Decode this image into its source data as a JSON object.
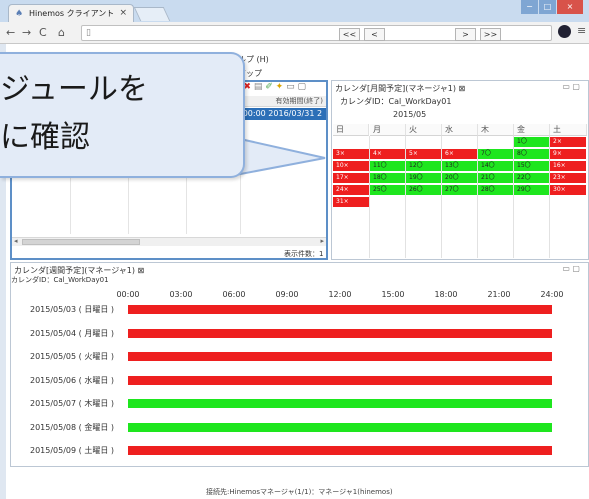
{
  "browser": {
    "tab_title": "Hinemos クライアント",
    "tab_close": "×",
    "address": "",
    "window_controls": [
      "−",
      "□",
      "×"
    ]
  },
  "app": {
    "menu_text": "ルプ (H)",
    "toolbar_text": "アップ",
    "list": {
      "header": "有効期間(終了)",
      "selected_row": ":00:00  2016/03/31 2",
      "count": "表示件数：1",
      "scroll_left": "◂",
      "scroll_right": "▸"
    },
    "monthly": {
      "title": "カレンダ[月間予定](マネージャ1) ⊠",
      "calendar_id": "カレンダID：Cal_WorkDay01",
      "nav": [
        "<<",
        "<",
        ">",
        ">>"
      ],
      "month": "2015/05",
      "weekdays": [
        "日",
        "月",
        "火",
        "水",
        "木",
        "金",
        "土"
      ],
      "weeks": [
        [
          null,
          null,
          null,
          null,
          null,
          {
            "label": "1〇",
            "color": "green"
          },
          {
            "label": "2×",
            "color": "red"
          }
        ],
        [
          {
            "label": "3×",
            "color": "red"
          },
          {
            "label": "4×",
            "color": "red"
          },
          {
            "label": "5×",
            "color": "red"
          },
          {
            "label": "6×",
            "color": "red"
          },
          {
            "label": "7〇",
            "color": "green"
          },
          {
            "label": "8〇",
            "color": "green"
          },
          {
            "label": "9×",
            "color": "red"
          }
        ],
        [
          {
            "label": "10×",
            "color": "red"
          },
          {
            "label": "11〇",
            "color": "green"
          },
          {
            "label": "12〇",
            "color": "green"
          },
          {
            "label": "13〇",
            "color": "green"
          },
          {
            "label": "14〇",
            "color": "green"
          },
          {
            "label": "15〇",
            "color": "green"
          },
          {
            "label": "16×",
            "color": "red"
          }
        ],
        [
          {
            "label": "17×",
            "color": "red"
          },
          {
            "label": "18〇",
            "color": "green"
          },
          {
            "label": "19〇",
            "color": "green"
          },
          {
            "label": "20〇",
            "color": "green"
          },
          {
            "label": "21〇",
            "color": "green"
          },
          {
            "label": "22〇",
            "color": "green"
          },
          {
            "label": "23×",
            "color": "red"
          }
        ],
        [
          {
            "label": "24×",
            "color": "red"
          },
          {
            "label": "25〇",
            "color": "green"
          },
          {
            "label": "26〇",
            "color": "green"
          },
          {
            "label": "27〇",
            "color": "green"
          },
          {
            "label": "28〇",
            "color": "green"
          },
          {
            "label": "29〇",
            "color": "green"
          },
          {
            "label": "30×",
            "color": "red"
          }
        ],
        [
          {
            "label": "31×",
            "color": "red"
          },
          null,
          null,
          null,
          null,
          null,
          null
        ]
      ]
    },
    "weekly": {
      "title": "カレンダ[週間予定](マネージャ1) ⊠",
      "calendar_id": "カレンダID：Cal_WorkDay01",
      "time_ticks": [
        "00:00",
        "03:00",
        "06:00",
        "09:00",
        "12:00",
        "15:00",
        "18:00",
        "21:00",
        "24:00"
      ],
      "days": [
        {
          "label": "2015/05/03 ( 日曜日 )",
          "color": "red"
        },
        {
          "label": "2015/05/04 ( 月曜日 )",
          "color": "red"
        },
        {
          "label": "2015/05/05 ( 火曜日 )",
          "color": "red"
        },
        {
          "label": "2015/05/06 ( 水曜日 )",
          "color": "red"
        },
        {
          "label": "2015/05/07 ( 木曜日 )",
          "color": "green"
        },
        {
          "label": "2015/05/08 ( 金曜日 )",
          "color": "green"
        },
        {
          "label": "2015/05/09 ( 土曜日 )",
          "color": "red"
        }
      ]
    },
    "status": "接続先:Hinemosマネージャ(1/1)：マネージャ1(hinemos)",
    "panel_controls": "▭ ▢"
  },
  "callout": {
    "line1": "ジュールを",
    "line2": "に確認"
  },
  "colors": {
    "red": "#ee1f1f",
    "green": "#1ee61e",
    "selection": "#2c6fb7",
    "callout_bg": "#e3ebf7",
    "callout_border": "#8fb0dd"
  }
}
